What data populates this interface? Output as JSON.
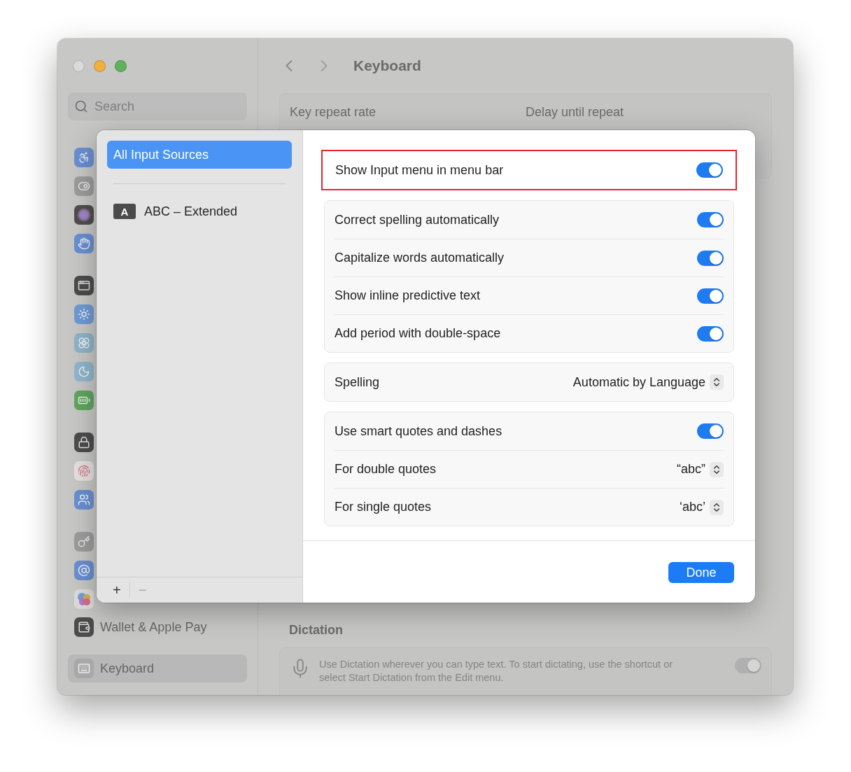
{
  "window": {
    "title": "Keyboard"
  },
  "sidebar": {
    "search": {
      "placeholder": "Search"
    },
    "sections": [
      {
        "items": [
          {
            "selected": false
          },
          {
            "selected": false
          },
          {
            "selected": false
          },
          {
            "selected": false
          }
        ]
      },
      {
        "items": [
          {
            "selected": false
          },
          {
            "selected": false
          },
          {
            "selected": false
          },
          {
            "selected": false
          },
          {
            "selected": false
          }
        ]
      },
      {
        "items": [
          {
            "selected": false
          },
          {
            "selected": false
          },
          {
            "selected": false
          }
        ]
      },
      {
        "items": [
          {
            "selected": false
          },
          {
            "selected": false
          },
          {
            "selected": false
          },
          {
            "label": "Wallet & Apple Pay",
            "selected": false
          }
        ]
      },
      {
        "items": [
          {
            "label": "Keyboard",
            "selected": true
          }
        ]
      }
    ]
  },
  "content": {
    "key_repeat": {
      "labels": [
        "Key repeat rate",
        "Delay until repeat"
      ]
    },
    "dictation": {
      "heading": "Dictation",
      "description": "Use Dictation wherever you can type text. To start dictating, use the shortcut or select Start Dictation from the Edit menu.",
      "on": true,
      "disabled": true
    }
  },
  "sheet": {
    "sources": {
      "items": [
        {
          "kind": "header",
          "label": "All Input Sources",
          "selected": true
        },
        {
          "kind": "source",
          "badge": "A",
          "label": "ABC – Extended",
          "selected": false
        }
      ],
      "add": "+",
      "remove": "−"
    },
    "groups": [
      {
        "highlighted": true,
        "rows": [
          {
            "kind": "toggle",
            "label": "Show Input menu in menu bar",
            "on": true
          }
        ]
      },
      {
        "highlighted": false,
        "rows": [
          {
            "kind": "toggle",
            "label": "Correct spelling automatically",
            "on": true
          },
          {
            "kind": "toggle",
            "label": "Capitalize words automatically",
            "on": true
          },
          {
            "kind": "toggle",
            "label": "Show inline predictive text",
            "on": true
          },
          {
            "kind": "toggle",
            "label": "Add period with double-space",
            "on": true
          }
        ]
      },
      {
        "highlighted": false,
        "rows": [
          {
            "kind": "popup",
            "label": "Spelling",
            "value": "Automatic by Language"
          }
        ]
      },
      {
        "highlighted": false,
        "rows": [
          {
            "kind": "toggle",
            "label": "Use smart quotes and dashes",
            "on": true
          },
          {
            "kind": "popup",
            "label": "For double quotes",
            "value": "“abc”"
          },
          {
            "kind": "popup",
            "label": "For single quotes",
            "value": "‘abc’"
          }
        ]
      }
    ],
    "done": "Done"
  }
}
